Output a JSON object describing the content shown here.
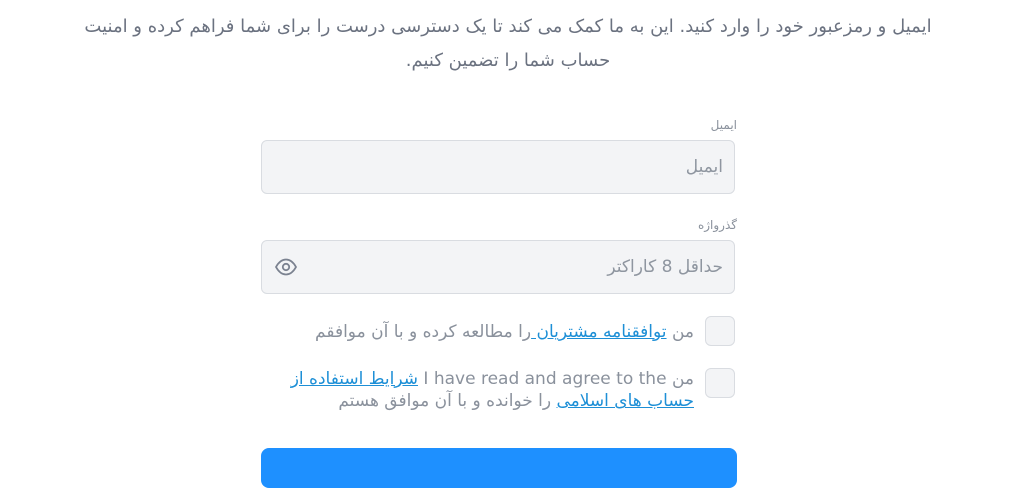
{
  "intro": {
    "line1": "ایمیل و رمزعبور خود را وارد کنید. این به ما کمک می کند تا یک دسترسی درست را برای شما فراهم کرده و امنیت",
    "line2": "حساب شما را تضمین کنیم."
  },
  "email": {
    "label": "ایمیل",
    "placeholder": "ایمیل"
  },
  "password": {
    "label": "گذرواژه",
    "placeholder": "حداقل 8 کاراکتر",
    "toggle_icon": "eye-icon"
  },
  "agreements": [
    {
      "prefix": "من ",
      "link": "توافقنامه مشتریان ",
      "suffix": "را مطالعه کرده و با آن موافقم"
    },
    {
      "prefix": "من ",
      "english": "I have read and agree to the",
      "link": "شرایط استفاده از حساب های اسلامی",
      "suffix": " را خوانده و با آن موافق هستم"
    }
  ],
  "colors": {
    "accent": "#1e90ff",
    "link": "#1d8fd6",
    "input_bg": "#f3f4f6",
    "text": "#6b7280"
  }
}
